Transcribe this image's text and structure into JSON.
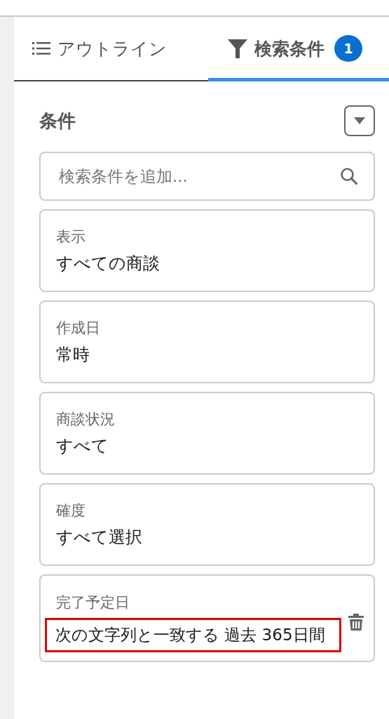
{
  "tabs": [
    {
      "label": "アウトライン",
      "selected": false
    },
    {
      "label": "検索条件",
      "badge": "1",
      "selected": true
    }
  ],
  "filters": {
    "title": "条件",
    "search": {
      "placeholder": "検索条件を追加..."
    },
    "items": [
      {
        "label": "表示",
        "value": "すべての商談",
        "removable": false,
        "highlighted": false
      },
      {
        "label": "作成日",
        "value": "常時",
        "removable": false,
        "highlighted": false
      },
      {
        "label": "商談状況",
        "value": "すべて",
        "removable": false,
        "highlighted": false
      },
      {
        "label": "確度",
        "value": "すべて選択",
        "removable": false,
        "highlighted": false
      },
      {
        "label": "完了予定日",
        "value": "次の文字列と一致する 過去 365日間",
        "removable": true,
        "highlighted": true
      }
    ]
  }
}
